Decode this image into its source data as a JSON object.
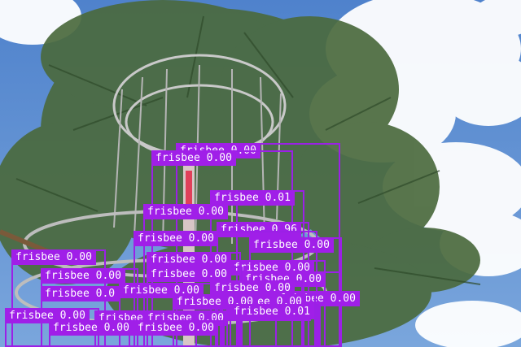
{
  "detections": [
    {
      "label": "frisbee 0.00"
    },
    {
      "label": "frisbee 0.00"
    },
    {
      "label": "frisbee 0.01"
    },
    {
      "label": "frisbee 0.00"
    },
    {
      "label": "frisbee 0.96"
    },
    {
      "label": "frisbee 0.00"
    },
    {
      "label": "frisbee 0.00"
    },
    {
      "label": "frisbee 0.00"
    },
    {
      "label": "frisbee 0.00"
    },
    {
      "label": "frisbee 0.00"
    },
    {
      "label": "frisbee 0.00"
    },
    {
      "label": "frisbee 0.00"
    },
    {
      "label": "frisbee 0.00"
    },
    {
      "label": "frisbee 0.0"
    },
    {
      "label": "frisbee 0.00"
    },
    {
      "label": "frisbee 0.00"
    },
    {
      "label": "frisbee 0.00"
    },
    {
      "label": "frisbee 0.00"
    },
    {
      "label": "frisbee 0.00"
    },
    {
      "label": "frisbee 0.00"
    },
    {
      "label": "frisbee 0.00"
    },
    {
      "label": "frisbee 0.00"
    },
    {
      "label": "frisbee 0.00"
    },
    {
      "label": "frisbee 0.01"
    },
    {
      "label": "frisbee 0.00"
    },
    {
      "label": "frisbee 0.00"
    }
  ]
}
